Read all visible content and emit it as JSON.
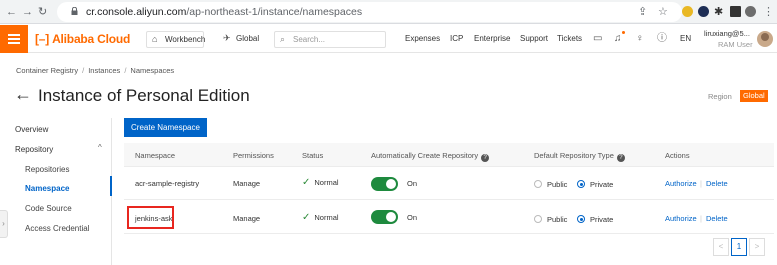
{
  "browser": {
    "url_host": "cr.console.aliyun.com",
    "url_path": "/ap-northeast-1/instance/namespaces"
  },
  "header": {
    "logo_text": "Alibaba Cloud",
    "workbench_label": "Workbench",
    "global_label": "Global",
    "search_placeholder": "Search...",
    "nav": [
      "Expenses",
      "ICP",
      "Enterprise",
      "Support",
      "Tickets"
    ],
    "lang": "EN",
    "user_name": "liruxiang@5...",
    "user_role": "RAM User",
    "accent_color": "#ff6a00"
  },
  "breadcrumb": [
    "Container Registry",
    "Instances",
    "Namespaces"
  ],
  "page": {
    "title": "Instance of Personal Edition",
    "region_label": "Region",
    "region_value": "Global"
  },
  "sidebar": {
    "items": [
      {
        "label": "Overview"
      },
      {
        "label": "Repository"
      },
      {
        "label": "Repositories"
      },
      {
        "label": "Namespace"
      },
      {
        "label": "Code Source"
      },
      {
        "label": "Access Credential"
      }
    ],
    "active": "Namespace"
  },
  "main": {
    "create_button": "Create Namespace",
    "columns": [
      "Namespace",
      "Permissions",
      "Status",
      "Automatically Create Repository",
      "Default Repository Type",
      "Actions"
    ],
    "rows": [
      {
        "namespace": "acr-sample-registry",
        "permissions": "Manage",
        "status": "Normal",
        "auto_create": "On",
        "public_label": "Public",
        "private_label": "Private",
        "default_type": "Private",
        "authorize": "Authorize",
        "delete": "Delete"
      },
      {
        "namespace": "jenkins-ask",
        "permissions": "Manage",
        "status": "Normal",
        "auto_create": "On",
        "public_label": "Public",
        "private_label": "Private",
        "default_type": "Private",
        "authorize": "Authorize",
        "delete": "Delete"
      }
    ],
    "pagination": {
      "prev": "<",
      "current": "1",
      "next": ">"
    }
  }
}
